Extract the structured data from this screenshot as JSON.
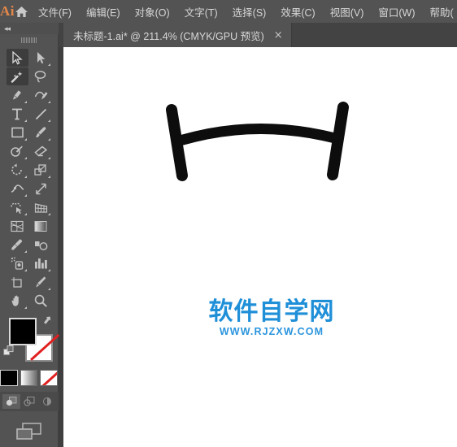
{
  "app": {
    "name": "Ai",
    "logo_color": "#e4884a",
    "home_icon": "home-icon"
  },
  "menubar": {
    "items": [
      {
        "label": "文件(F)",
        "name": "menu-file"
      },
      {
        "label": "编辑(E)",
        "name": "menu-edit"
      },
      {
        "label": "对象(O)",
        "name": "menu-object"
      },
      {
        "label": "文字(T)",
        "name": "menu-type"
      },
      {
        "label": "选择(S)",
        "name": "menu-select"
      },
      {
        "label": "效果(C)",
        "name": "menu-effect"
      },
      {
        "label": "视图(V)",
        "name": "menu-view"
      },
      {
        "label": "窗口(W)",
        "name": "menu-window"
      },
      {
        "label": "帮助(",
        "name": "menu-help"
      }
    ]
  },
  "tabbar": {
    "tab_title": "未标题-1.ai* @ 211.4% (CMYK/GPU 预览)",
    "close_label": "×"
  },
  "toolpanel": {
    "collapse_label": "◂◂",
    "tools": [
      {
        "name": "selection-tool",
        "active": true,
        "has_corner": false
      },
      {
        "name": "direct-selection-tool",
        "active": false,
        "has_corner": true
      },
      {
        "name": "magic-wand-tool",
        "active": true,
        "has_corner": false
      },
      {
        "name": "lasso-tool",
        "active": false,
        "has_corner": false
      },
      {
        "name": "pen-tool",
        "active": false,
        "has_corner": true
      },
      {
        "name": "curvature-tool",
        "active": false,
        "has_corner": true
      },
      {
        "name": "type-tool",
        "active": false,
        "has_corner": true
      },
      {
        "name": "line-segment-tool",
        "active": false,
        "has_corner": true
      },
      {
        "name": "rectangle-tool",
        "active": false,
        "has_corner": true
      },
      {
        "name": "paintbrush-tool",
        "active": false,
        "has_corner": true
      },
      {
        "name": "shaper-tool",
        "active": false,
        "has_corner": true
      },
      {
        "name": "eraser-tool",
        "active": false,
        "has_corner": true
      },
      {
        "name": "rotate-tool",
        "active": false,
        "has_corner": true
      },
      {
        "name": "scale-tool",
        "active": false,
        "has_corner": true
      },
      {
        "name": "width-tool",
        "active": false,
        "has_corner": true
      },
      {
        "name": "free-transform-tool",
        "active": false,
        "has_corner": false
      },
      {
        "name": "shape-builder-tool",
        "active": false,
        "has_corner": true
      },
      {
        "name": "perspective-grid-tool",
        "active": false,
        "has_corner": true
      },
      {
        "name": "mesh-tool",
        "active": false,
        "has_corner": false
      },
      {
        "name": "gradient-tool",
        "active": false,
        "has_corner": false
      },
      {
        "name": "eyedropper-tool",
        "active": false,
        "has_corner": true
      },
      {
        "name": "blend-tool",
        "active": false,
        "has_corner": false
      },
      {
        "name": "symbol-sprayer-tool",
        "active": false,
        "has_corner": true
      },
      {
        "name": "column-graph-tool",
        "active": false,
        "has_corner": true
      },
      {
        "name": "artboard-tool",
        "active": false,
        "has_corner": false
      },
      {
        "name": "slice-tool",
        "active": false,
        "has_corner": true
      },
      {
        "name": "hand-tool",
        "active": false,
        "has_corner": true
      },
      {
        "name": "zoom-tool",
        "active": false,
        "has_corner": false
      }
    ],
    "colors": {
      "fill": "#000000",
      "stroke": "none",
      "stroke_none_slash": "#e02020"
    },
    "color_modes": [
      {
        "name": "color-mode-button",
        "selected": true
      },
      {
        "name": "gradient-mode-button",
        "selected": false
      },
      {
        "name": "none-mode-button",
        "selected": false
      }
    ],
    "draw_modes": [
      {
        "name": "draw-normal-button",
        "selected": true
      },
      {
        "name": "draw-behind-button",
        "selected": false
      },
      {
        "name": "draw-inside-button",
        "selected": false
      }
    ],
    "screen_mode": {
      "name": "change-screen-mode-button"
    }
  },
  "canvas": {
    "background": "#ffffff",
    "artwork": {
      "name": "h-shape-path",
      "stroke_color": "#0d0d0d",
      "description": "H-shaped path with curved horizontal bar and two rounded vertical strokes"
    },
    "watermark": {
      "cn_text": "软件自学网",
      "en_text": "WWW.RJZXW.COM",
      "color": "#1f8fd8"
    }
  }
}
